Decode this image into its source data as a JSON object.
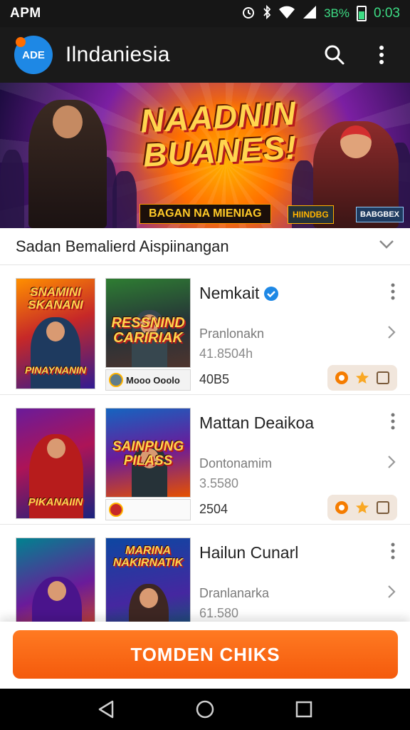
{
  "status_bar": {
    "left_text": "APM",
    "battery_text": "3B%",
    "clock": "0:03"
  },
  "app_bar": {
    "logo_text": "ADE",
    "title": "Ilndaniesia",
    "icons": [
      "search-icon",
      "more-vertical-icon"
    ]
  },
  "banner": {
    "title_line1": "NAADNIN",
    "title_line2": "BUANES!",
    "subtitle": "BAGAN NA MIENIAG",
    "badge1": "HIINDBG",
    "badge2": "BABGBEX"
  },
  "section": {
    "title": "Sadan Bemalierd Aispiinangan"
  },
  "items": [
    {
      "thumb_a_title": "SNAMINI SKANANI",
      "thumb_a_caption": "PINAYNANIN",
      "thumb_b_title": "RESSNIND CARIRIAK",
      "dev_label": "Mooo Ooolo",
      "name": "Nemkait",
      "verified": true,
      "subtitle": "Pranlonakn",
      "count": "41.8504h",
      "size": "40B5",
      "chip_icons": [
        "coin-icon",
        "star-icon",
        "square-icon"
      ]
    },
    {
      "thumb_a_title": "",
      "thumb_a_caption": "PIKANAIIN",
      "thumb_b_title": "SAINPUNG PILASS",
      "dev_label": "",
      "name": "Mattan Deaikoa",
      "verified": false,
      "subtitle": "Dontonamim",
      "count": "3.5580",
      "size": "2504",
      "chip_icons": [
        "coin-icon",
        "star-icon",
        "square-icon"
      ]
    },
    {
      "thumb_a_title": "",
      "thumb_a_caption": "",
      "thumb_b_title": "MARINA NAKIRNATIK",
      "dev_label": "",
      "name": "Hailun Cunarl",
      "verified": false,
      "subtitle": "Dranlanarka",
      "count": "61.580",
      "size": "",
      "chip_icons": []
    }
  ],
  "cta": {
    "label": "TOMDEN CHIKS"
  },
  "nav_bar": {
    "icons": [
      "back-icon",
      "home-icon",
      "recents-icon"
    ]
  },
  "colors": {
    "accent": "#f4600e",
    "app_bar": "#1a1a1a",
    "verified": "#1e88e5"
  }
}
